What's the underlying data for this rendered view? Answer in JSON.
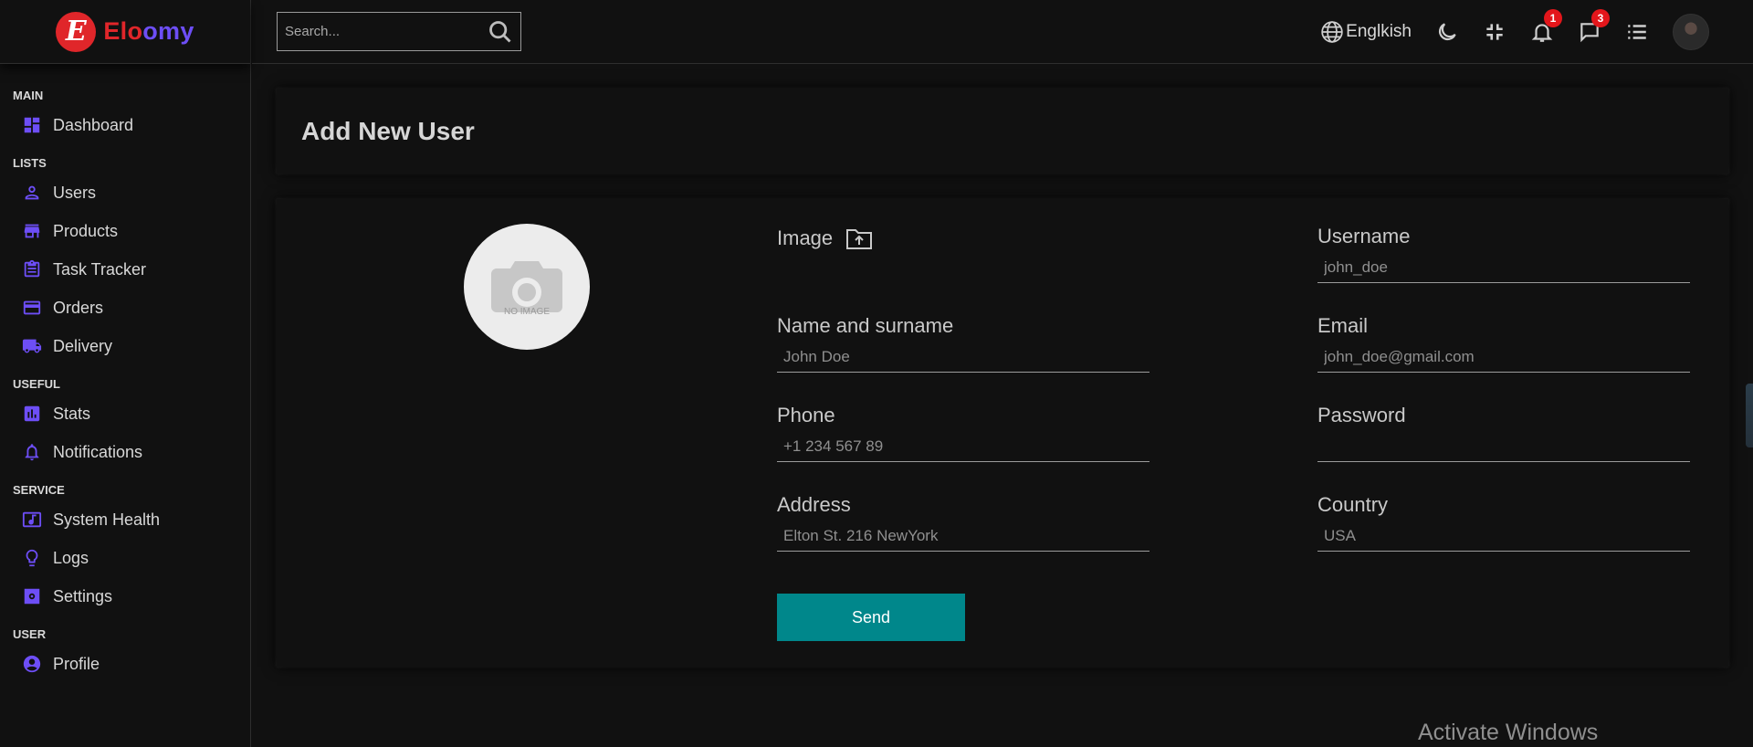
{
  "brand": {
    "prefix": "Elo",
    "suffix": "omy",
    "badge_letter": "E"
  },
  "search": {
    "placeholder": "Search..."
  },
  "topbar": {
    "language": "Englkish",
    "notifications_count": "1",
    "messages_count": "3"
  },
  "sidebar": {
    "sections": [
      {
        "title": "MAIN",
        "items": [
          {
            "label": "Dashboard",
            "icon": "dashboard-icon"
          }
        ]
      },
      {
        "title": "LISTS",
        "items": [
          {
            "label": "Users",
            "icon": "user-icon"
          },
          {
            "label": "Products",
            "icon": "store-icon"
          },
          {
            "label": "Task Tracker",
            "icon": "clipboard-icon"
          },
          {
            "label": "Orders",
            "icon": "credit-card-icon"
          },
          {
            "label": "Delivery",
            "icon": "truck-icon"
          }
        ]
      },
      {
        "title": "USEFUL",
        "items": [
          {
            "label": "Stats",
            "icon": "chart-icon"
          },
          {
            "label": "Notifications",
            "icon": "bell-icon"
          }
        ]
      },
      {
        "title": "SERVICE",
        "items": [
          {
            "label": "System Health",
            "icon": "cloud-icon"
          },
          {
            "label": "Logs",
            "icon": "psychology-icon"
          },
          {
            "label": "Settings",
            "icon": "settings-icon"
          }
        ]
      },
      {
        "title": "USER",
        "items": [
          {
            "label": "Profile",
            "icon": "profile-icon"
          }
        ]
      }
    ]
  },
  "page": {
    "title": "Add New User"
  },
  "form": {
    "preview_text": "NO IMAGE",
    "image_label": "Image",
    "fields": {
      "username": {
        "label": "Username",
        "placeholder": "john_doe"
      },
      "name": {
        "label": "Name and surname",
        "placeholder": "John Doe"
      },
      "email": {
        "label": "Email",
        "placeholder": "john_doe@gmail.com"
      },
      "phone": {
        "label": "Phone",
        "placeholder": "+1 234 567 89"
      },
      "password": {
        "label": "Password",
        "placeholder": ""
      },
      "address": {
        "label": "Address",
        "placeholder": "Elton St. 216 NewYork"
      },
      "country": {
        "label": "Country",
        "placeholder": "USA"
      }
    },
    "send_label": "Send"
  },
  "watermark": "Activate Windows",
  "colors": {
    "accent": "#6d4ef6",
    "brand_red": "#e0262a",
    "button": "#00878b",
    "background": "#111111"
  }
}
